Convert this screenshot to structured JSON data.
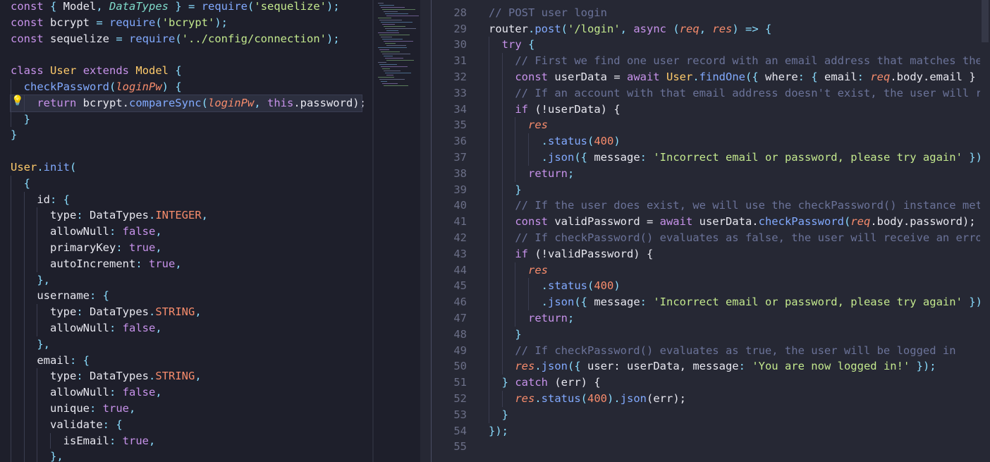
{
  "colors": {
    "keyword": "#c792ea",
    "kwBlue": "#82aaff",
    "string": "#c3e88d",
    "variable": "#e8e8f0",
    "param": "#f78c6c",
    "property": "#e8e8f0",
    "function": "#82aaff",
    "type": "#7fdbca",
    "bool": "#c792ea",
    "comment": "#6b7399",
    "punct": "#89ddff",
    "number": "#f78c6c",
    "orange": "#f07178",
    "yellow": "#ffcb6b",
    "teal": "#7fdbca"
  },
  "left": {
    "lines": [
      [
        [
          "const",
          "keyword"
        ],
        [
          " { ",
          "punct"
        ],
        [
          "Model",
          "variable"
        ],
        [
          ", ",
          "punct"
        ],
        [
          "DataTypes",
          "type"
        ],
        [
          " } = ",
          "punct"
        ],
        [
          "require",
          "function"
        ],
        [
          "(",
          "punct"
        ],
        [
          "'sequelize'",
          "string"
        ],
        [
          ");",
          "punct"
        ]
      ],
      [
        [
          "const",
          "keyword"
        ],
        [
          " ",
          "punct"
        ],
        [
          "bcrypt",
          "variable"
        ],
        [
          " = ",
          "punct"
        ],
        [
          "require",
          "function"
        ],
        [
          "(",
          "punct"
        ],
        [
          "'bcrypt'",
          "string"
        ],
        [
          ");",
          "punct"
        ]
      ],
      [
        [
          "const",
          "keyword"
        ],
        [
          " ",
          "punct"
        ],
        [
          "sequelize",
          "variable"
        ],
        [
          " = ",
          "punct"
        ],
        [
          "require",
          "function"
        ],
        [
          "(",
          "punct"
        ],
        [
          "'../config/connection'",
          "string"
        ],
        [
          ");",
          "punct"
        ]
      ],
      [],
      [
        [
          "class",
          "keyword"
        ],
        [
          " ",
          "punct"
        ],
        [
          "User",
          "yellow"
        ],
        [
          " ",
          "punct"
        ],
        [
          "extends",
          "keyword"
        ],
        [
          " ",
          "punct"
        ],
        [
          "Model",
          "yellow"
        ],
        [
          " {",
          "punct"
        ]
      ],
      [
        [
          "  ",
          "punct"
        ],
        [
          "checkPassword",
          "function"
        ],
        [
          "(",
          "punct"
        ],
        [
          "loginPw",
          "param"
        ],
        [
          ") {",
          "punct"
        ]
      ],
      [
        [
          "    ",
          "punct"
        ],
        [
          "return",
          "keyword"
        ],
        [
          " bcrypt.",
          "variable"
        ],
        [
          "compareSync",
          "function"
        ],
        [
          "(",
          "punct"
        ],
        [
          "loginPw",
          "param"
        ],
        [
          ", ",
          "punct"
        ],
        [
          "this",
          "keyword"
        ],
        [
          ".password);",
          "variable"
        ]
      ],
      [
        [
          "  }",
          "punct"
        ]
      ],
      [
        [
          "}",
          "punct"
        ]
      ],
      [],
      [
        [
          "User",
          "yellow"
        ],
        [
          ".",
          "punct"
        ],
        [
          "init",
          "function"
        ],
        [
          "(",
          "punct"
        ]
      ],
      [
        [
          "  {",
          "punct"
        ]
      ],
      [
        [
          "    ",
          "punct"
        ],
        [
          "id",
          "variable"
        ],
        [
          ": {",
          "punct"
        ]
      ],
      [
        [
          "      ",
          "punct"
        ],
        [
          "type",
          "variable"
        ],
        [
          ": ",
          "punct"
        ],
        [
          "DataTypes",
          "variable"
        ],
        [
          ".",
          "punct"
        ],
        [
          "INTEGER",
          "number"
        ],
        [
          ",",
          "punct"
        ]
      ],
      [
        [
          "      ",
          "punct"
        ],
        [
          "allowNull",
          "variable"
        ],
        [
          ": ",
          "punct"
        ],
        [
          "false",
          "bool"
        ],
        [
          ",",
          "punct"
        ]
      ],
      [
        [
          "      ",
          "punct"
        ],
        [
          "primaryKey",
          "variable"
        ],
        [
          ": ",
          "punct"
        ],
        [
          "true",
          "bool"
        ],
        [
          ",",
          "punct"
        ]
      ],
      [
        [
          "      ",
          "punct"
        ],
        [
          "autoIncrement",
          "variable"
        ],
        [
          ": ",
          "punct"
        ],
        [
          "true",
          "bool"
        ],
        [
          ",",
          "punct"
        ]
      ],
      [
        [
          "    },",
          "punct"
        ]
      ],
      [
        [
          "    ",
          "punct"
        ],
        [
          "username",
          "variable"
        ],
        [
          ": {",
          "punct"
        ]
      ],
      [
        [
          "      ",
          "punct"
        ],
        [
          "type",
          "variable"
        ],
        [
          ": ",
          "punct"
        ],
        [
          "DataTypes",
          "variable"
        ],
        [
          ".",
          "punct"
        ],
        [
          "STRING",
          "number"
        ],
        [
          ",",
          "punct"
        ]
      ],
      [
        [
          "      ",
          "punct"
        ],
        [
          "allowNull",
          "variable"
        ],
        [
          ": ",
          "punct"
        ],
        [
          "false",
          "bool"
        ],
        [
          ",",
          "punct"
        ]
      ],
      [
        [
          "    },",
          "punct"
        ]
      ],
      [
        [
          "    ",
          "punct"
        ],
        [
          "email",
          "variable"
        ],
        [
          ": {",
          "punct"
        ]
      ],
      [
        [
          "      ",
          "punct"
        ],
        [
          "type",
          "variable"
        ],
        [
          ": ",
          "punct"
        ],
        [
          "DataTypes",
          "variable"
        ],
        [
          ".",
          "punct"
        ],
        [
          "STRING",
          "number"
        ],
        [
          ",",
          "punct"
        ]
      ],
      [
        [
          "      ",
          "punct"
        ],
        [
          "allowNull",
          "variable"
        ],
        [
          ": ",
          "punct"
        ],
        [
          "false",
          "bool"
        ],
        [
          ",",
          "punct"
        ]
      ],
      [
        [
          "      ",
          "punct"
        ],
        [
          "unique",
          "variable"
        ],
        [
          ": ",
          "punct"
        ],
        [
          "true",
          "bool"
        ],
        [
          ",",
          "punct"
        ]
      ],
      [
        [
          "      ",
          "punct"
        ],
        [
          "validate",
          "variable"
        ],
        [
          ": {",
          "punct"
        ]
      ],
      [
        [
          "        ",
          "punct"
        ],
        [
          "isEmail",
          "variable"
        ],
        [
          ": ",
          "punct"
        ],
        [
          "true",
          "bool"
        ],
        [
          ",",
          "punct"
        ]
      ],
      [
        [
          "      },",
          "punct"
        ]
      ]
    ]
  },
  "right": {
    "startLine": 27,
    "lines": [
      [],
      [
        [
          "// POST user login",
          "comment"
        ]
      ],
      [
        [
          "router",
          "variable"
        ],
        [
          ".",
          "punct"
        ],
        [
          "post",
          "function"
        ],
        [
          "(",
          "punct"
        ],
        [
          "'/login'",
          "string"
        ],
        [
          ", ",
          "punct"
        ],
        [
          "async",
          "keyword"
        ],
        [
          " (",
          "punct"
        ],
        [
          "req",
          "param"
        ],
        [
          ", ",
          "punct"
        ],
        [
          "res",
          "param"
        ],
        [
          ") => {",
          "punct"
        ]
      ],
      [
        [
          "  ",
          "punct"
        ],
        [
          "try",
          "keyword"
        ],
        [
          " {",
          "punct"
        ]
      ],
      [
        [
          "    ",
          "punct"
        ],
        [
          "// First we find one user record with an email address that matches the",
          "comment"
        ]
      ],
      [
        [
          "    ",
          "punct"
        ],
        [
          "const",
          "keyword"
        ],
        [
          " userData = ",
          "variable"
        ],
        [
          "await",
          "keyword"
        ],
        [
          " ",
          "punct"
        ],
        [
          "User",
          "yellow"
        ],
        [
          ".",
          "punct"
        ],
        [
          "findOne",
          "function"
        ],
        [
          "({ ",
          "punct"
        ],
        [
          "where",
          "variable"
        ],
        [
          ": { ",
          "punct"
        ],
        [
          "email",
          "variable"
        ],
        [
          ": ",
          "punct"
        ],
        [
          "req",
          "param"
        ],
        [
          ".body.email } }",
          "variable"
        ]
      ],
      [
        [
          "    ",
          "punct"
        ],
        [
          "// If an account with that email address doesn't exist, the user will re",
          "comment"
        ]
      ],
      [
        [
          "    ",
          "punct"
        ],
        [
          "if",
          "keyword"
        ],
        [
          " (!userData) {",
          "variable"
        ]
      ],
      [
        [
          "      ",
          "punct"
        ],
        [
          "res",
          "param"
        ]
      ],
      [
        [
          "        .",
          "punct"
        ],
        [
          "status",
          "function"
        ],
        [
          "(",
          "punct"
        ],
        [
          "400",
          "number"
        ],
        [
          ")",
          "punct"
        ]
      ],
      [
        [
          "        .",
          "punct"
        ],
        [
          "json",
          "function"
        ],
        [
          "({ ",
          "punct"
        ],
        [
          "message",
          "variable"
        ],
        [
          ": ",
          "punct"
        ],
        [
          "'Incorrect email or password, please try again'",
          "string"
        ],
        [
          " });",
          "punct"
        ]
      ],
      [
        [
          "      ",
          "punct"
        ],
        [
          "return",
          "keyword"
        ],
        [
          ";",
          "punct"
        ]
      ],
      [
        [
          "    }",
          "punct"
        ]
      ],
      [
        [
          "    ",
          "punct"
        ],
        [
          "// If the user does exist, we will use the checkPassword() instance meth",
          "comment"
        ]
      ],
      [
        [
          "    ",
          "punct"
        ],
        [
          "const",
          "keyword"
        ],
        [
          " validPassword = ",
          "variable"
        ],
        [
          "await",
          "keyword"
        ],
        [
          " userData.",
          "variable"
        ],
        [
          "checkPassword",
          "function"
        ],
        [
          "(",
          "punct"
        ],
        [
          "req",
          "param"
        ],
        [
          ".body.password);",
          "variable"
        ]
      ],
      [
        [
          "    ",
          "punct"
        ],
        [
          "// If checkPassword() evaluates as false, the user will receive an error",
          "comment"
        ]
      ],
      [
        [
          "    ",
          "punct"
        ],
        [
          "if",
          "keyword"
        ],
        [
          " (!validPassword) {",
          "variable"
        ]
      ],
      [
        [
          "      ",
          "punct"
        ],
        [
          "res",
          "param"
        ]
      ],
      [
        [
          "        .",
          "punct"
        ],
        [
          "status",
          "function"
        ],
        [
          "(",
          "punct"
        ],
        [
          "400",
          "number"
        ],
        [
          ")",
          "punct"
        ]
      ],
      [
        [
          "        .",
          "punct"
        ],
        [
          "json",
          "function"
        ],
        [
          "({ ",
          "punct"
        ],
        [
          "message",
          "variable"
        ],
        [
          ": ",
          "punct"
        ],
        [
          "'Incorrect email or password, please try again'",
          "string"
        ],
        [
          " });",
          "punct"
        ]
      ],
      [
        [
          "      ",
          "punct"
        ],
        [
          "return",
          "keyword"
        ],
        [
          ";",
          "punct"
        ]
      ],
      [
        [
          "    }",
          "punct"
        ]
      ],
      [
        [
          "    ",
          "punct"
        ],
        [
          "// If checkPassword() evaluates as true, the user will be logged in",
          "comment"
        ]
      ],
      [
        [
          "    ",
          "punct"
        ],
        [
          "res",
          "param"
        ],
        [
          ".",
          "punct"
        ],
        [
          "json",
          "function"
        ],
        [
          "({ ",
          "punct"
        ],
        [
          "user",
          "variable"
        ],
        [
          ": userData, ",
          "variable"
        ],
        [
          "message",
          "variable"
        ],
        [
          ": ",
          "punct"
        ],
        [
          "'You are now logged in!'",
          "string"
        ],
        [
          " });",
          "punct"
        ]
      ],
      [
        [
          "  } ",
          "punct"
        ],
        [
          "catch",
          "keyword"
        ],
        [
          " (err) {",
          "variable"
        ]
      ],
      [
        [
          "    ",
          "punct"
        ],
        [
          "res",
          "param"
        ],
        [
          ".",
          "punct"
        ],
        [
          "status",
          "function"
        ],
        [
          "(",
          "punct"
        ],
        [
          "400",
          "number"
        ],
        [
          ").",
          "punct"
        ],
        [
          "json",
          "function"
        ],
        [
          "(err);",
          "variable"
        ]
      ],
      [
        [
          "  }",
          "punct"
        ]
      ],
      [
        [
          "});",
          "punct"
        ]
      ],
      []
    ]
  }
}
